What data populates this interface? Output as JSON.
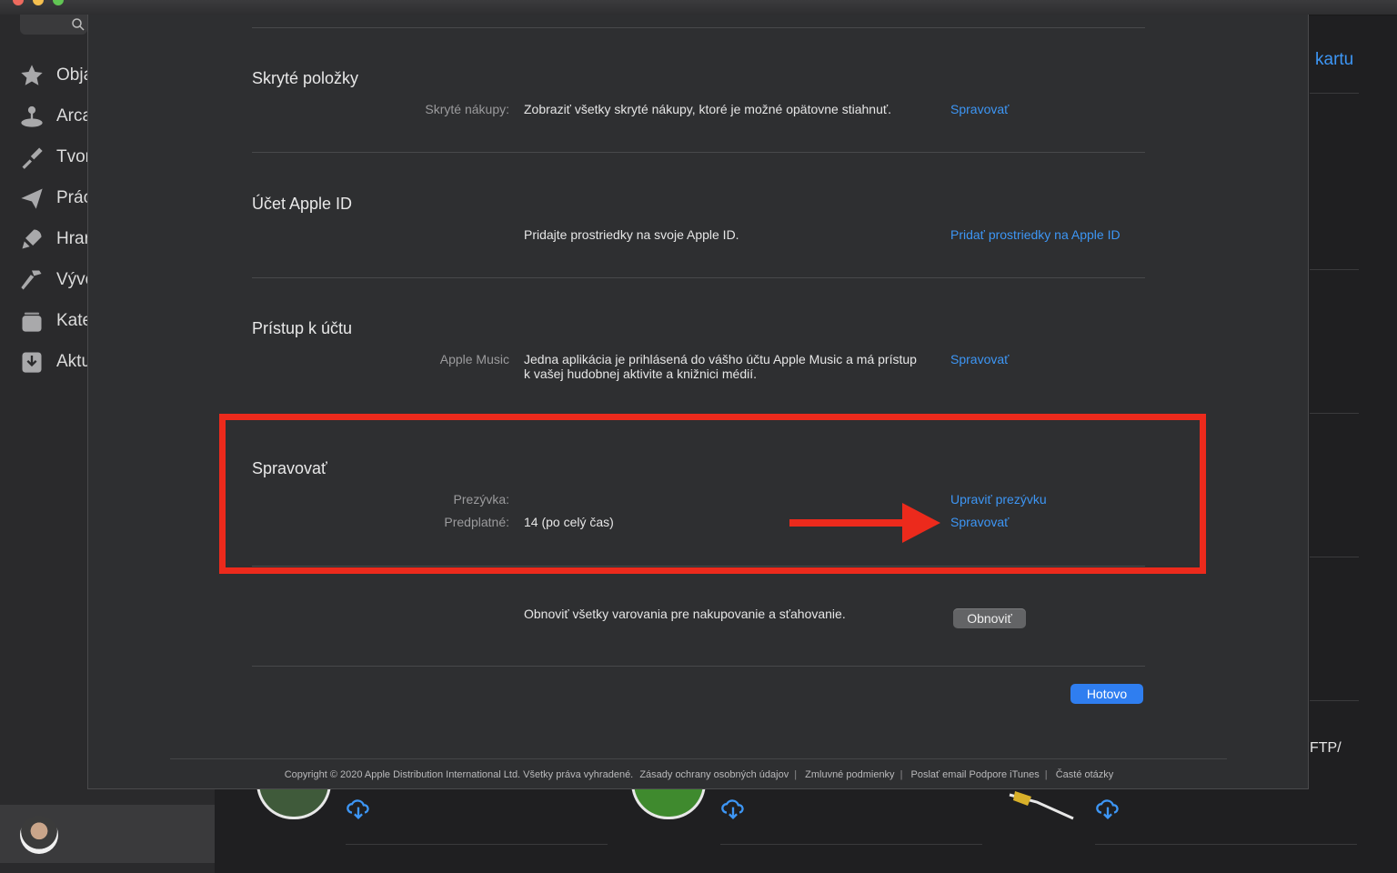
{
  "sidebar": {
    "items": [
      {
        "label": "Obja",
        "icon": "star-icon"
      },
      {
        "label": "Arca",
        "icon": "joystick-icon"
      },
      {
        "label": "Tvor",
        "icon": "brush-icon"
      },
      {
        "label": "Prác",
        "icon": "paper-plane-icon"
      },
      {
        "label": "Hrar",
        "icon": "rocket-icon"
      },
      {
        "label": "Vývo",
        "icon": "hammer-icon"
      },
      {
        "label": "Kate",
        "icon": "category-stack-icon"
      },
      {
        "label": "Aktu",
        "icon": "download-tray-icon"
      }
    ]
  },
  "background": {
    "kartu_link": "kartu",
    "ftp_text": "FTP/"
  },
  "modal": {
    "hidden_items": {
      "title": "Skryté položky",
      "label": "Skryté nákupy:",
      "description": "Zobraziť všetky skryté nákupy, ktoré je možné opätovne stiahnuť.",
      "action": "Spravovať"
    },
    "apple_id": {
      "title": "Účet Apple ID",
      "description": "Pridajte prostriedky na svoje Apple ID.",
      "action": "Pridať prostriedky na Apple ID"
    },
    "account_access": {
      "title": "Prístup k účtu",
      "label": "Apple Music",
      "description": "Jedna aplikácia je prihlásená do vášho účtu Apple Music a má prístup k vašej hudobnej aktivite a knižnici médií.",
      "action": "Spravovať"
    },
    "manage": {
      "title": "Spravovať",
      "nickname_label": "Prezývka:",
      "nickname_action": "Upraviť prezývku",
      "subscriptions_label": "Predplatné:",
      "subscriptions_value": "14 (po celý čas)",
      "subscriptions_action": "Spravovať"
    },
    "reset": {
      "description": "Obnoviť všetky varovania pre nakupovanie a sťahovanie.",
      "button": "Obnoviť"
    },
    "done_button": "Hotovo",
    "footer": {
      "copyright": "Copyright © 2020 Apple Distribution International Ltd. Všetky práva vyhradené.",
      "links": [
        "Zásady ochrany osobných údajov",
        "Zmluvné podmienky",
        "Poslať email Podpore iTunes",
        "Časté otázky"
      ]
    }
  },
  "colors": {
    "link": "#3d96f5",
    "annotation": "#ec2a1c",
    "primary_button": "#2f7ef0"
  }
}
